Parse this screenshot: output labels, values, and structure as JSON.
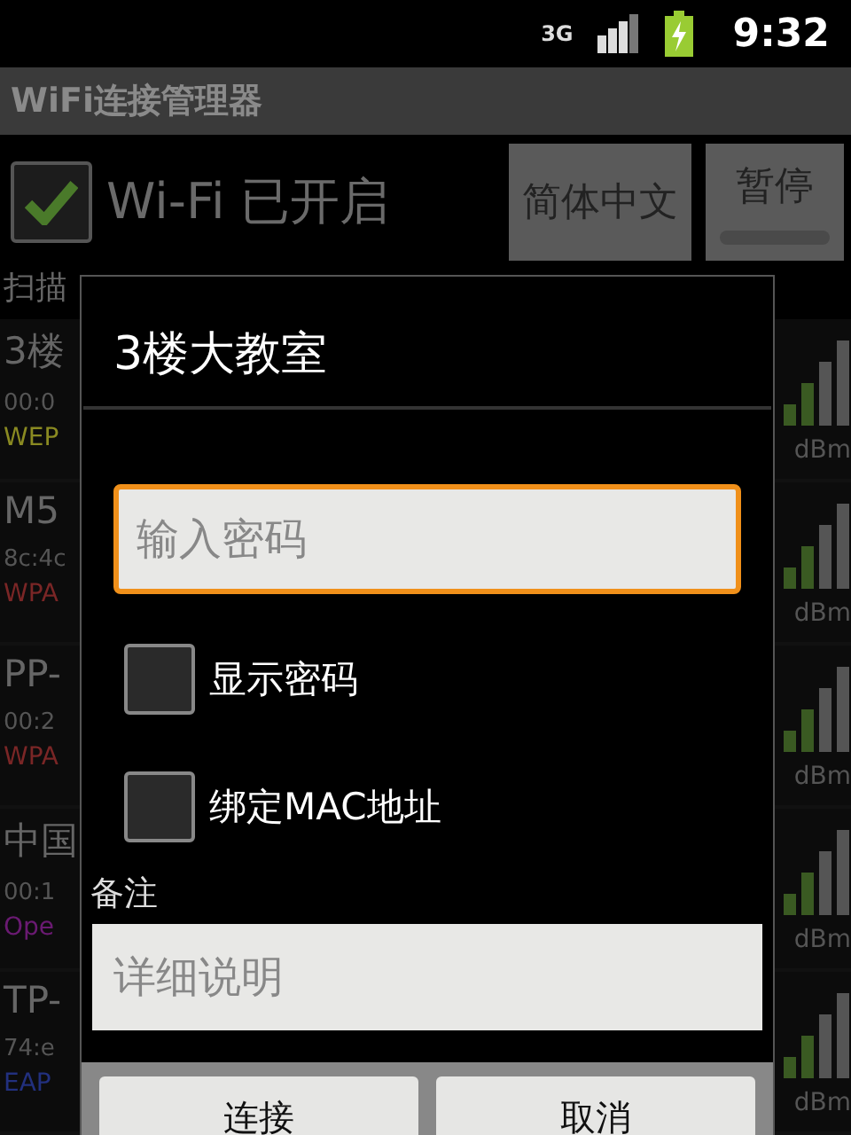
{
  "status_bar": {
    "network": "3G",
    "time": "9:32"
  },
  "app_title": "WiFi连接管理器",
  "wifi_toggle": {
    "label": "Wi-Fi 已开启",
    "checked": true
  },
  "buttons": [
    {
      "label": "简体中文",
      "kind": "plain"
    },
    {
      "label": "暂停",
      "kind": "indicator"
    }
  ],
  "scan_label": "扫描",
  "networks": [
    {
      "name": "3楼",
      "mac": "00:0",
      "security": "WEP",
      "color": "#8a8a22",
      "unit": "dBm"
    },
    {
      "name": "M5",
      "mac": "8c:4c",
      "security": "WPA",
      "color": "#7a2626",
      "unit": "dBm"
    },
    {
      "name": "PP-",
      "mac": "00:2",
      "security": "WPA",
      "color": "#7a2626",
      "unit": "dBm"
    },
    {
      "name": "中国",
      "mac": "00:1",
      "security": "Ope",
      "color": "#6a1a72",
      "unit": "dBm"
    },
    {
      "name": "TP-",
      "mac": "74:e",
      "security": "EAP",
      "color": "#22307e",
      "unit": "dBm"
    }
  ],
  "dialog": {
    "title": "3楼大教室",
    "password": {
      "placeholder": "输入密码"
    },
    "options": [
      {
        "label": "显示密码",
        "checked": false
      },
      {
        "label": "绑定MAC地址",
        "checked": false
      }
    ],
    "note_label": "备注",
    "note": {
      "placeholder": "详细说明"
    },
    "buttons": [
      "连接",
      "取消"
    ]
  }
}
